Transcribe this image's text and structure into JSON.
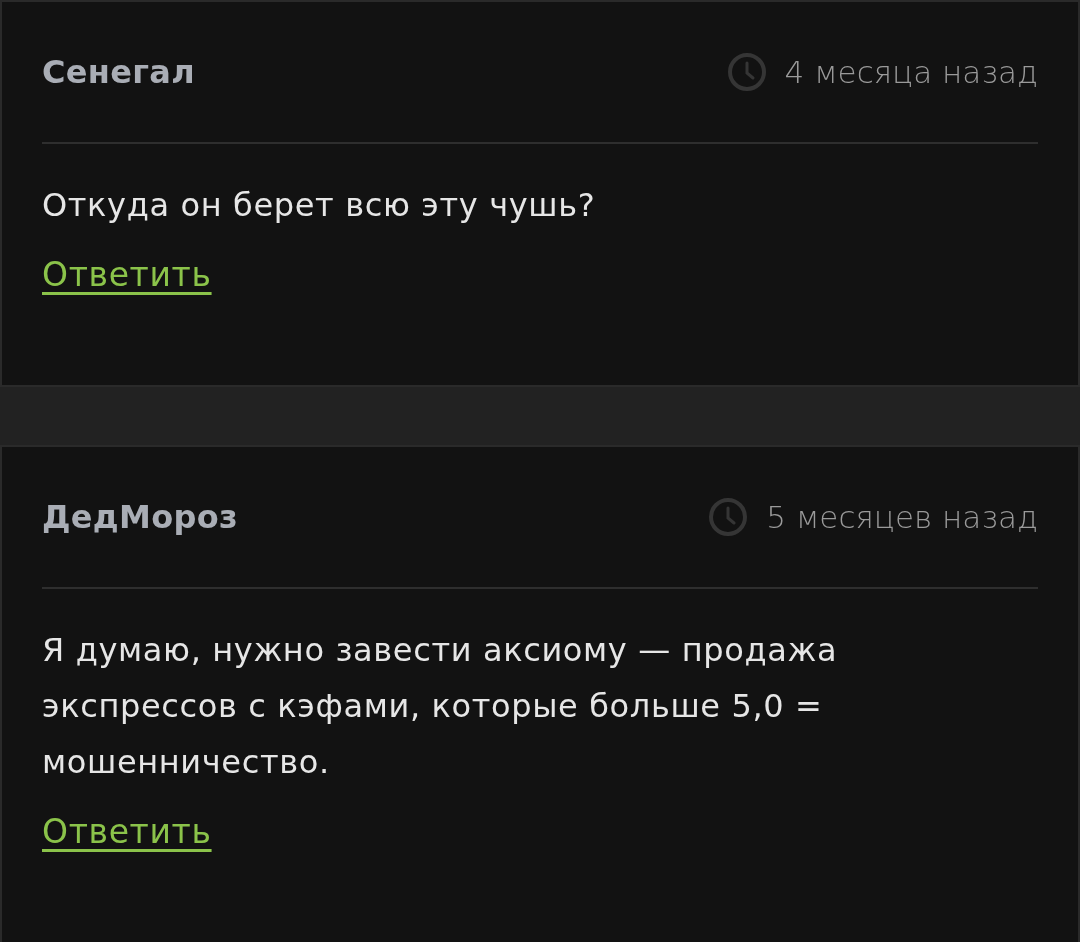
{
  "comments": [
    {
      "author": "Сенегал",
      "time": "4 месяца назад",
      "text": "Откуда он берет всю эту чушь?",
      "reply": "Ответить"
    },
    {
      "author": "ДедМороз",
      "time": "5 месяцев назад",
      "text": "Я думаю, нужно завести аксиому — продажа экспрессов с кэфами, которые больше 5,0 = мошенничество.",
      "reply": "Ответить"
    }
  ]
}
